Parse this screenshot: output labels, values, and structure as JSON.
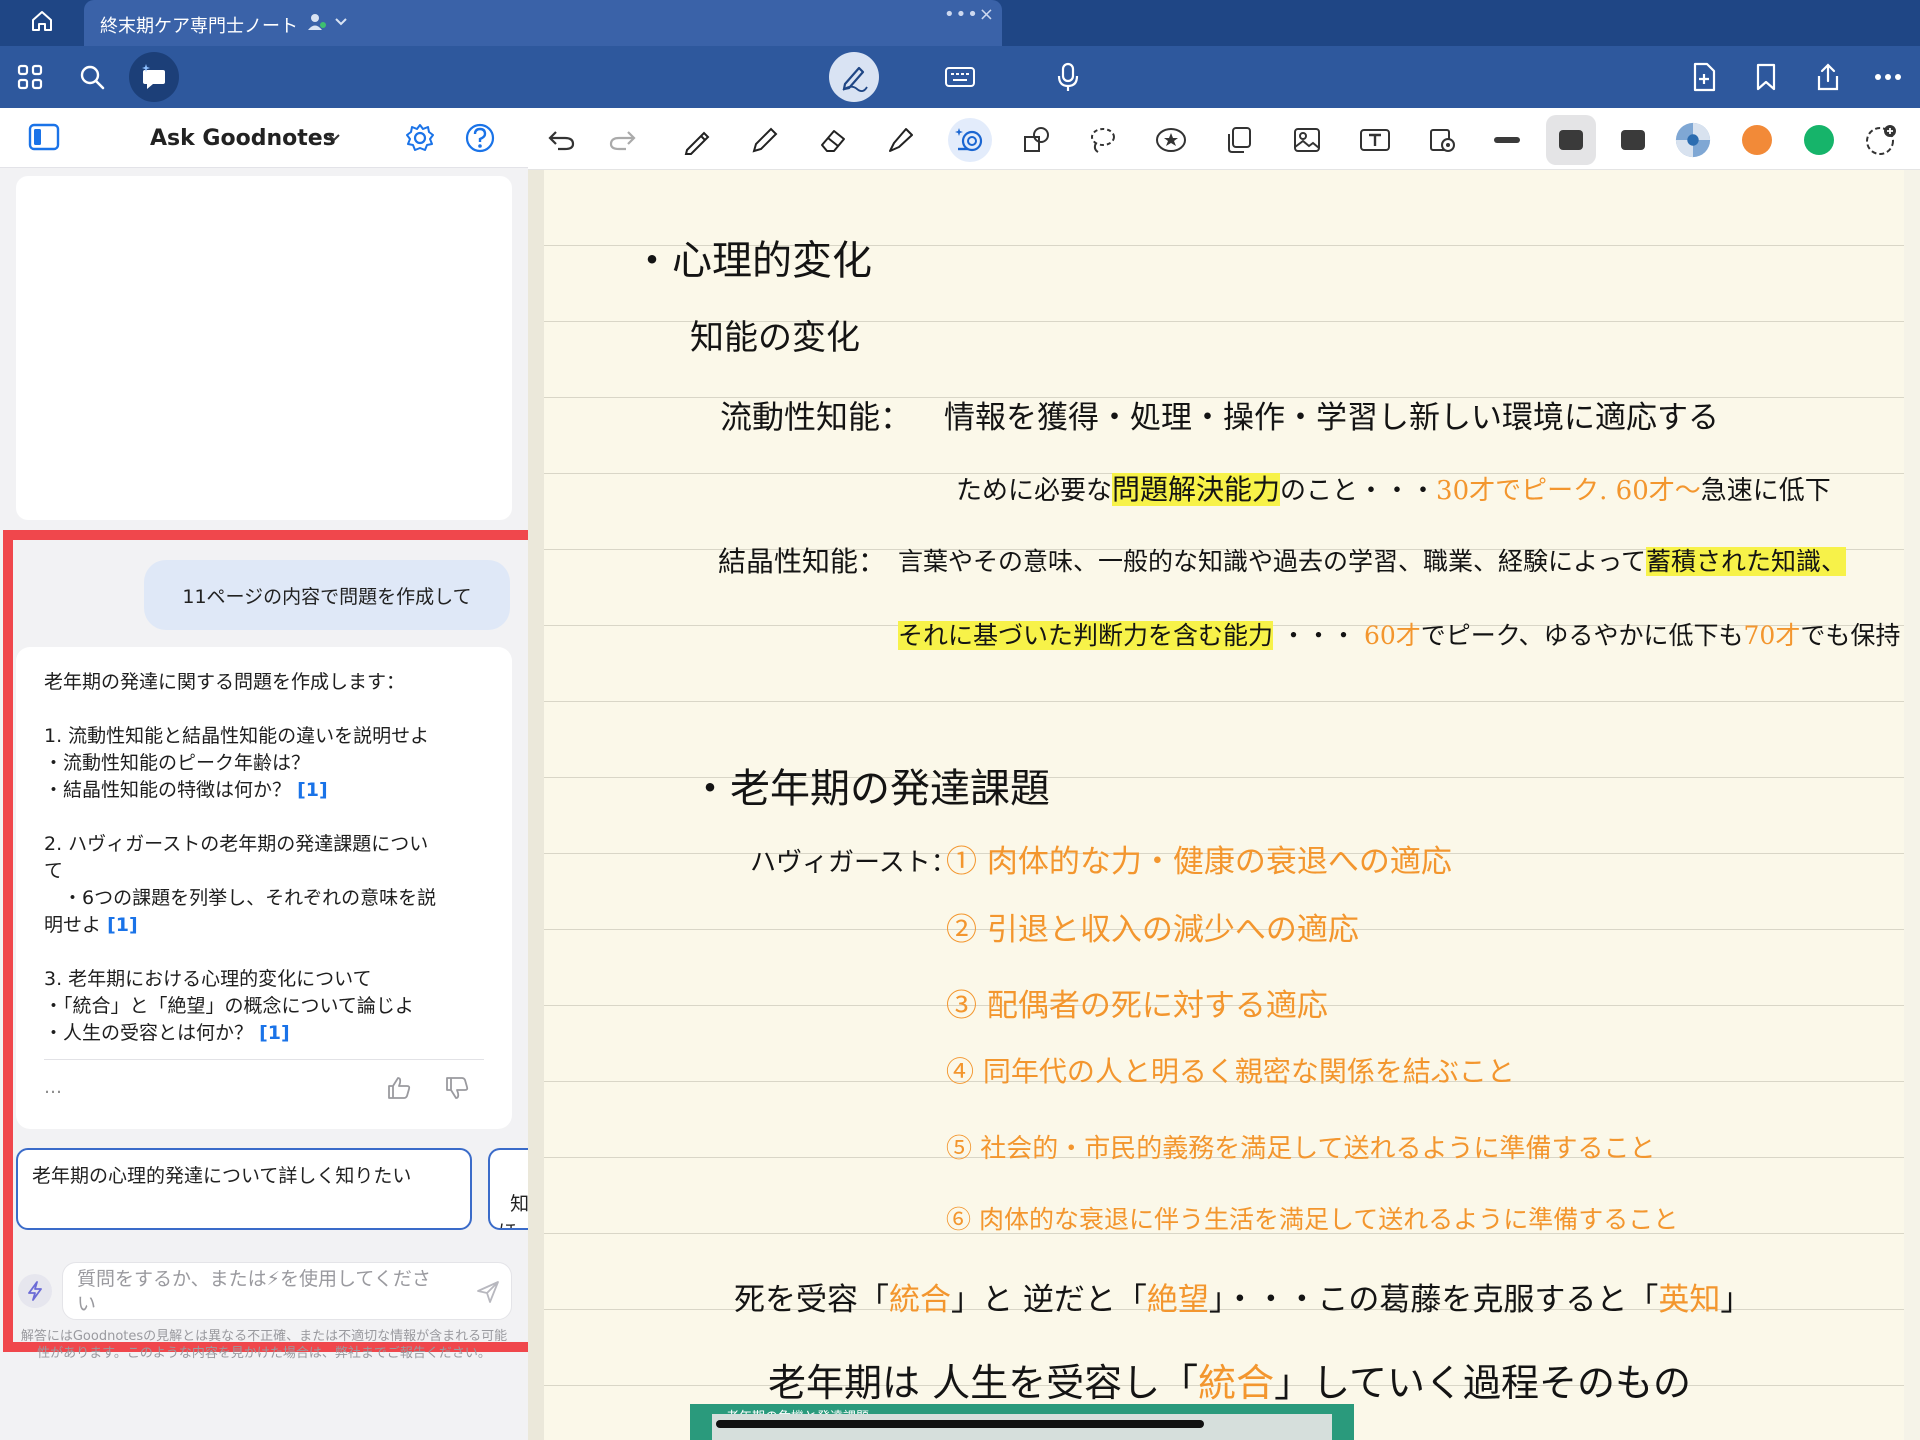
{
  "tab": {
    "title": "終末期ケア専門士ノート"
  },
  "panel": {
    "title": "Ask Goodnotes",
    "user_message": "11ページの内容で問題を作成して",
    "answer": {
      "intro": "老年期の発達に関する問題を作成します：",
      "q1_title": "1. 流動性知能と結晶性知能の違いを説明せよ",
      "q1_a": "・流動性知能のピーク年齢は？",
      "q1_b": "・結晶性知能の特徴は何か？",
      "q2_title_1": "2. ハヴィガーストの老年期の発達課題につい",
      "q2_title_2": "て",
      "q2_a_1": "　・6つの課題を列挙し、それぞれの意味を説",
      "q2_a_2": "明せよ",
      "q3_title": "3. 老年期における心理的変化について",
      "q3_a": "・「統合」と「絶望」の概念について論じよ",
      "q3_b": "・人生の受容とは何か？",
      "citation": "[1]",
      "more": "…"
    },
    "suggestions": [
      "老年期の心理的発達について詳しく知りたい",
      "知\nほ"
    ],
    "input_placeholder": "質問をするか、または⚡を使用してください",
    "disclaimer": "解答にはGoodnotesの見解とは異なる不正確、または不適切な情報が含まれる可能性があります。このような内容を見かけた場合は、弊社までご報告ください。"
  },
  "notes": {
    "h1": "・心理的変化",
    "h1_sub": "知能の変化",
    "fluid_label": "流動性知能：",
    "fluid_1": "情報を獲得・処理・操作・学習し新しい環境に適応する",
    "fluid_2a": "ために必要な",
    "fluid_2b": "問題解決能力",
    "fluid_2c": "のこと・・・",
    "fluid_2d": "30才でピーク.",
    "fluid_2e": "60才～",
    "fluid_2f": "急速に低下",
    "cryst_label": "結晶性知能：",
    "cryst_1a": "言葉やその意味、一般的な知識や過去の学習、職業、経験によって",
    "cryst_1b": "蓄積された知識、",
    "cryst_2a": "それに基づいた判断力を含む能力",
    "cryst_2b": "・・・",
    "cryst_2c": "60才",
    "cryst_2d": "でピーク、ゆるやかに低下も",
    "cryst_2e": "70才",
    "cryst_2f": "でも保持",
    "h2": "・老年期の発達課題",
    "havi_label": "ハヴィガースト：",
    "tasks": [
      "① 肉体的な力・健康の衰退への適応",
      "② 引退と収入の減少への適応",
      "③ 配偶者の死に対する適応",
      "④ 同年代の人と明るく親密な関係を結ぶこと",
      "⑤ 社会的・市民的義務を満足して送れるように準備すること",
      "⑥ 肉体的な衰退に伴う生活を満足して送れるように準備すること"
    ],
    "death_a": "死を受容「",
    "death_b": "統合",
    "death_c": "」と 逆だと「",
    "death_d": "絶望",
    "death_e": "」・・・この葛藤を克服すると「",
    "death_f": "英知",
    "death_g": "」",
    "last_a": "老年期は 人生を受容し「",
    "last_b": "統合",
    "last_c": "」していく過程そのもの",
    "book_caption": "老年期の危機と発達課題"
  },
  "colors": {
    "tabbar": "#1f4685",
    "toolbar": "#2e589d",
    "highlight_frame": "#f0474c",
    "ink_orange": "#f3962e",
    "marker_yellow": "#f7f249",
    "palette": [
      "#3a3a3a",
      "#3a3a3a",
      "#7fa7d4",
      "#f28a38",
      "#16b46a"
    ]
  }
}
